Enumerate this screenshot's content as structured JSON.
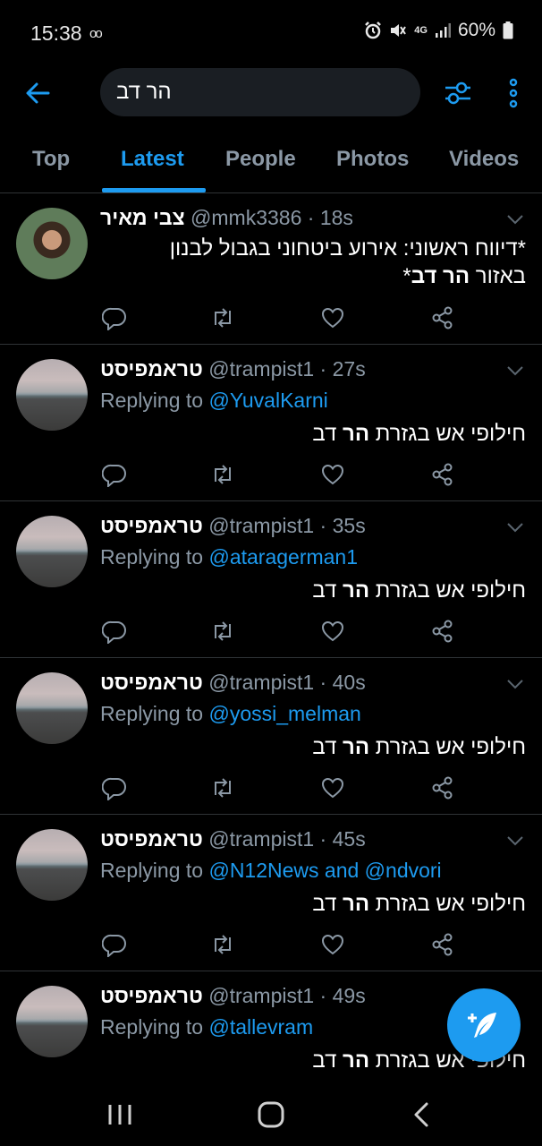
{
  "status_bar": {
    "time": "15:38",
    "voicemail_icon": "voicemail-icon",
    "network": "4G",
    "battery": "60%"
  },
  "search": {
    "query": "הר דב"
  },
  "tabs": [
    {
      "label": "Top",
      "active": false
    },
    {
      "label": "Latest",
      "active": true
    },
    {
      "label": "People",
      "active": false
    },
    {
      "label": "Photos",
      "active": false
    },
    {
      "label": "Videos",
      "active": false
    }
  ],
  "tweets": [
    {
      "display_name": "צבי מאיר",
      "handle": "@mmk3386",
      "sep": " · ",
      "time": "18s",
      "line1": "*דיווח ראשוני: אירוע ביטחוני בגבול לבנון",
      "line2_pre": "באזור ",
      "line2_bold": "הר דב",
      "line2_post": "*"
    },
    {
      "display_name": "טראמפיסט",
      "handle": "@trampist1",
      "sep": " · ",
      "time": "27s",
      "reply_prefix": "Replying to ",
      "reply_to": "@YuvalKarni",
      "text_pre": "חילופי אש בגזרת ",
      "text_bold": "הר",
      "text_post": " דב"
    },
    {
      "display_name": "טראמפיסט",
      "handle": "@trampist1",
      "sep": " · ",
      "time": "35s",
      "reply_prefix": "Replying to ",
      "reply_to": "@ataragerman1",
      "text_pre": "חילופי אש בגזרת ",
      "text_bold": "הר",
      "text_post": " דב"
    },
    {
      "display_name": "טראמפיסט",
      "handle": "@trampist1",
      "sep": " · ",
      "time": "40s",
      "reply_prefix": "Replying to ",
      "reply_to": "@yossi_melman",
      "text_pre": "חילופי אש בגזרת ",
      "text_bold": "הר",
      "text_post": " דב"
    },
    {
      "display_name": "טראמפיסט",
      "handle": "@trampist1",
      "sep": " · ",
      "time": "45s",
      "reply_prefix": "Replying to ",
      "reply_to": "@N12News and @ndvori",
      "text_pre": "חילופי אש בגזרת ",
      "text_bold": "הר",
      "text_post": " דב"
    },
    {
      "display_name": "טראמפיסט",
      "handle": "@trampist1",
      "sep": " · ",
      "time": "49s",
      "reply_prefix": "Replying to ",
      "reply_to": "@tallevram",
      "text_pre": "חילופי אש בגזרת ",
      "text_bold": "הר",
      "text_post": " דב"
    }
  ],
  "colors": {
    "accent": "#1d9bf0",
    "muted": "#8b98a5",
    "divider": "#2f3336",
    "search_bg": "#1a1e23"
  }
}
